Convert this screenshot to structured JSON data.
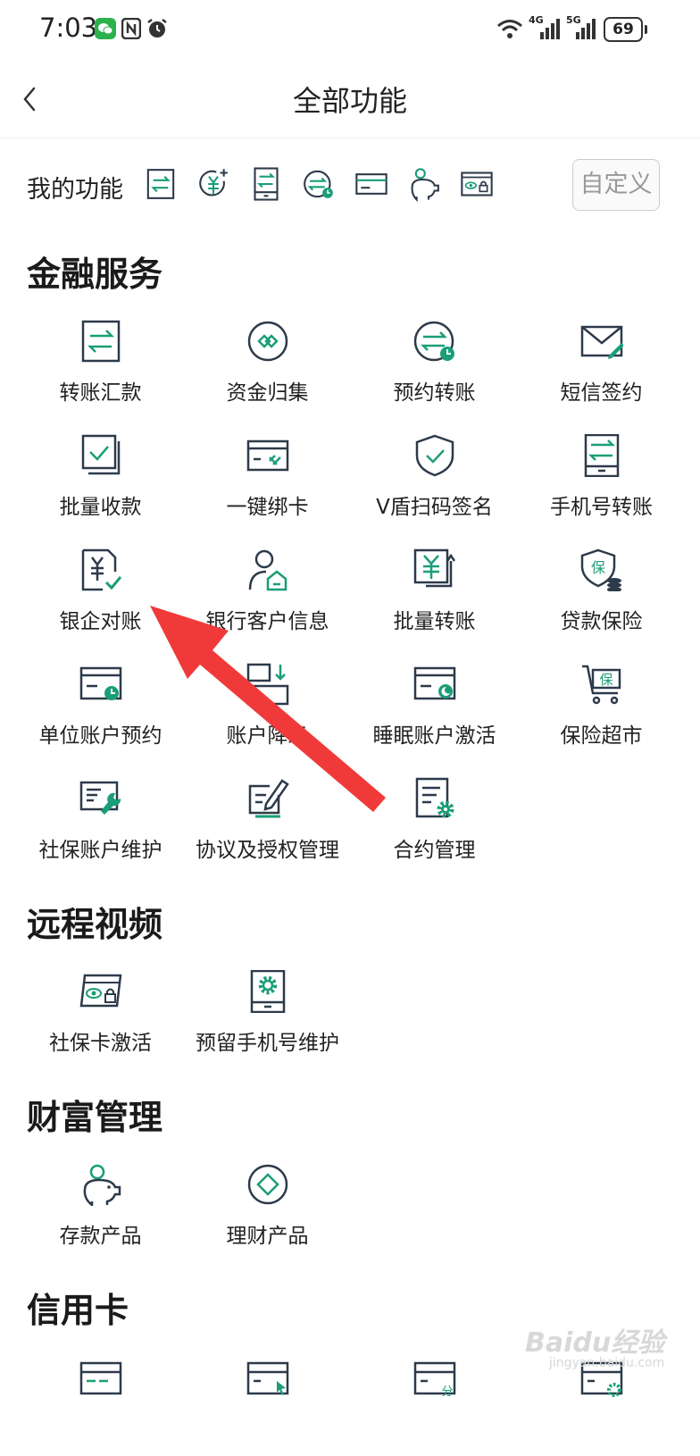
{
  "status_bar": {
    "time": "7:03",
    "battery": "69",
    "net1": "4G",
    "net2": "5G"
  },
  "header": {
    "title": "全部功能"
  },
  "my_functions": {
    "label": "我的功能",
    "icons": [
      "transfer-icon",
      "yuan-add-icon",
      "phone-transfer-icon",
      "scheduled-transfer-icon",
      "card-icon",
      "piggy-bank-icon",
      "card-lock-icon"
    ],
    "customize_label": "自定义"
  },
  "sections": [
    {
      "title": "金融服务",
      "items": [
        {
          "label": "转账汇款",
          "icon": "transfer-icon"
        },
        {
          "label": "资金归集",
          "icon": "fund-collect-icon"
        },
        {
          "label": "预约转账",
          "icon": "scheduled-transfer-icon"
        },
        {
          "label": "短信签约",
          "icon": "sms-sign-icon"
        },
        {
          "label": "批量收款",
          "icon": "batch-receive-icon"
        },
        {
          "label": "一键绑卡",
          "icon": "bind-card-icon"
        },
        {
          "label": "V盾扫码签名",
          "icon": "shield-icon"
        },
        {
          "label": "手机号转账",
          "icon": "phone-transfer-icon"
        },
        {
          "label": "银企对账",
          "icon": "reconcile-icon"
        },
        {
          "label": "银行客户信息",
          "icon": "customer-info-icon"
        },
        {
          "label": "批量转账",
          "icon": "batch-transfer-icon"
        },
        {
          "label": "贷款保险",
          "icon": "loan-insurance-icon"
        },
        {
          "label": "单位账户预约",
          "icon": "account-booking-icon"
        },
        {
          "label": "账户降级",
          "icon": "account-downgrade-icon"
        },
        {
          "label": "睡眠账户激活",
          "icon": "dormant-account-icon"
        },
        {
          "label": "保险超市",
          "icon": "insurance-cart-icon"
        },
        {
          "label": "社保账户维护",
          "icon": "social-maintain-icon"
        },
        {
          "label": "协议及授权管理",
          "icon": "agreement-icon"
        },
        {
          "label": "合约管理",
          "icon": "contract-icon"
        }
      ]
    },
    {
      "title": "远程视频",
      "items": [
        {
          "label": "社保卡激活",
          "icon": "card-lock-icon"
        },
        {
          "label": "预留手机号维护",
          "icon": "phone-settings-icon"
        }
      ]
    },
    {
      "title": "财富管理",
      "items": [
        {
          "label": "存款产品",
          "icon": "piggy-bank-icon"
        },
        {
          "label": "理财产品",
          "icon": "wealth-icon"
        }
      ]
    },
    {
      "title": "信用卡",
      "items": [
        {
          "label": "",
          "icon": "credit-card-icon"
        },
        {
          "label": "",
          "icon": "card-click-icon"
        },
        {
          "label": "",
          "icon": "card-installment-icon"
        },
        {
          "label": "",
          "icon": "card-settings-icon"
        }
      ]
    }
  ],
  "colors": {
    "accent": "#1a9e78",
    "stroke": "#2d3a4a",
    "arrow": "#f03a3a"
  },
  "watermark": {
    "text": "Baidu经验",
    "sub": "jingyan.baidu.com"
  }
}
